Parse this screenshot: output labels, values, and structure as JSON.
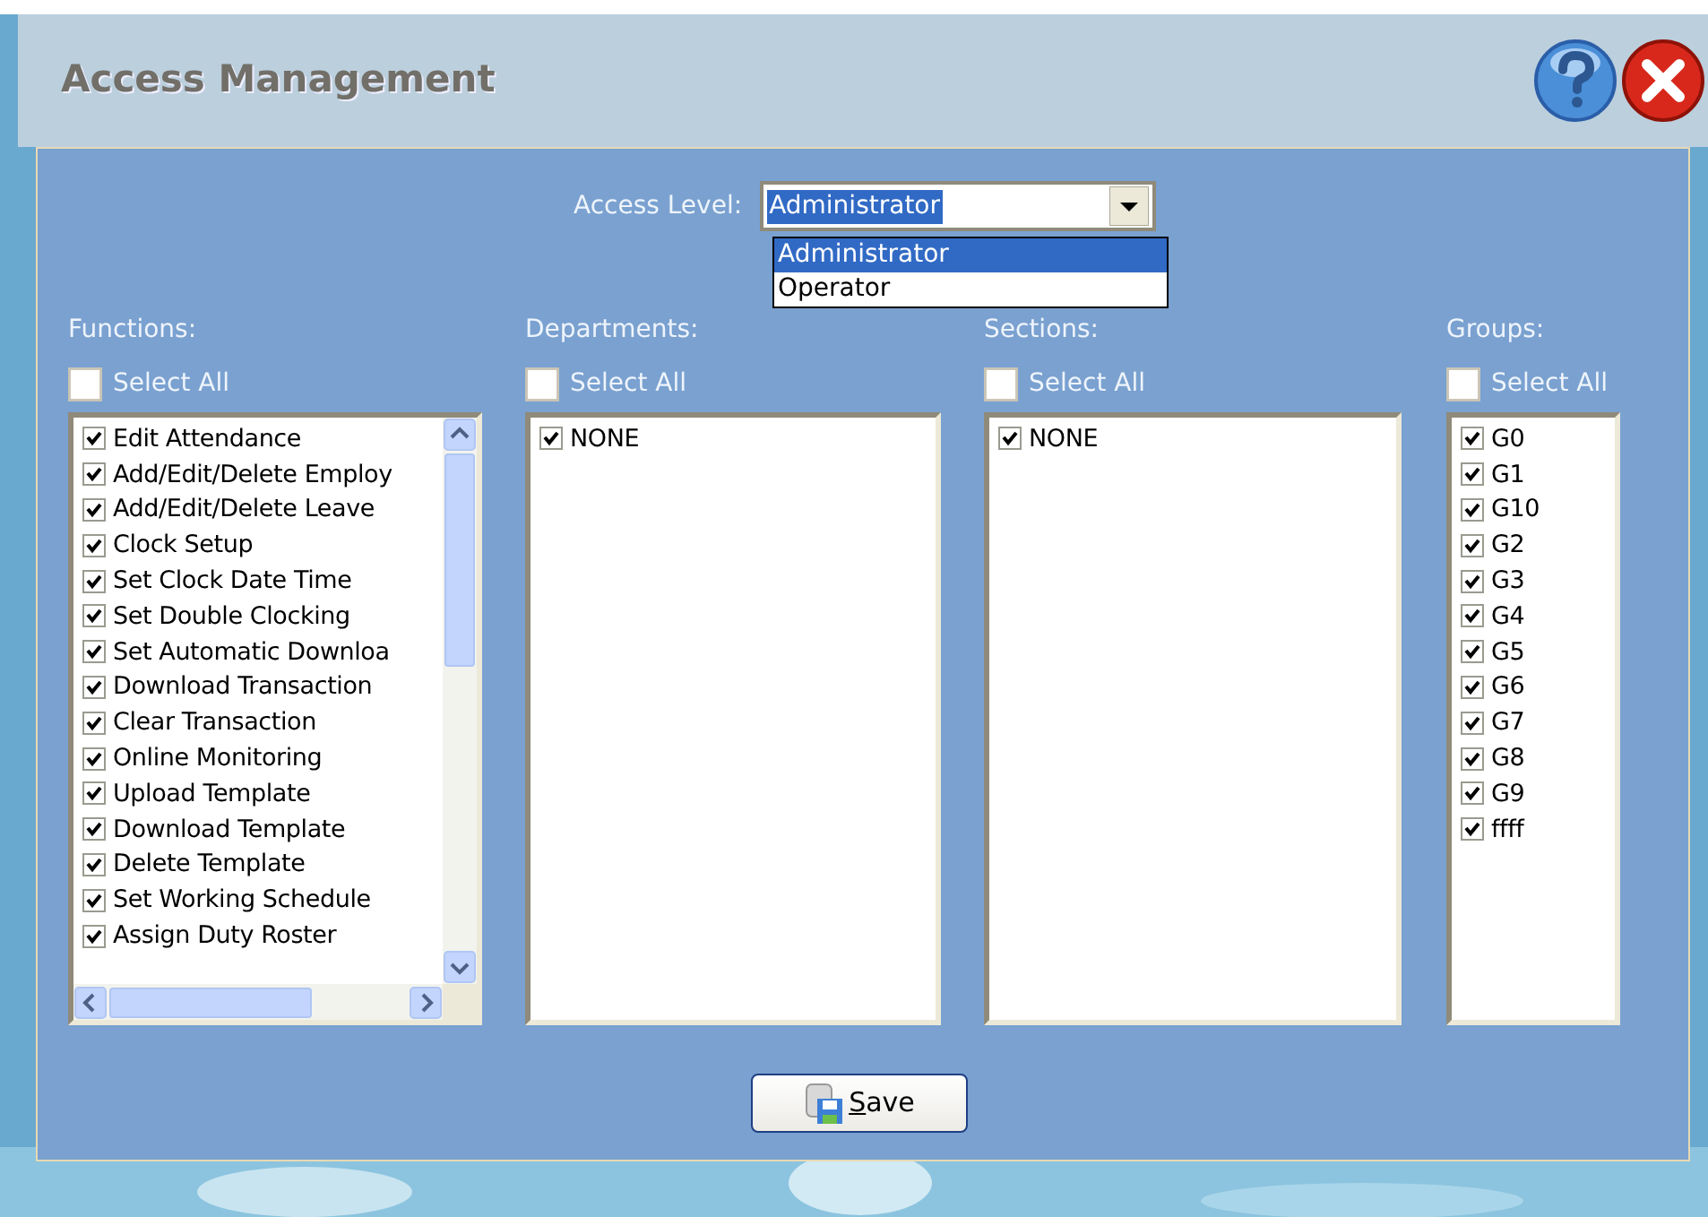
{
  "window": {
    "title": "Access Management"
  },
  "access_level": {
    "label": "Access Level:",
    "value": "Administrator",
    "expanded": true,
    "options": [
      {
        "label": "Administrator",
        "selected": true
      },
      {
        "label": "Operator",
        "selected": false
      }
    ]
  },
  "columns": [
    {
      "title": "Functions:",
      "select_all": {
        "label": "Select All",
        "checked": false
      },
      "scrollbars": true,
      "items": [
        {
          "label": "Edit Attendance",
          "checked": true
        },
        {
          "label": "Add/Edit/Delete Employ",
          "checked": true
        },
        {
          "label": "Add/Edit/Delete Leave",
          "checked": true
        },
        {
          "label": "Clock Setup",
          "checked": true
        },
        {
          "label": "Set Clock Date Time",
          "checked": true
        },
        {
          "label": "Set Double Clocking",
          "checked": true
        },
        {
          "label": "Set Automatic Downloa",
          "checked": true
        },
        {
          "label": "Download Transaction",
          "checked": true
        },
        {
          "label": "Clear Transaction",
          "checked": true
        },
        {
          "label": "Online Monitoring",
          "checked": true
        },
        {
          "label": "Upload Template",
          "checked": true
        },
        {
          "label": "Download Template",
          "checked": true
        },
        {
          "label": "Delete Template",
          "checked": true
        },
        {
          "label": "Set Working Schedule",
          "checked": true
        },
        {
          "label": "Assign Duty Roster",
          "checked": true
        }
      ]
    },
    {
      "title": "Departments:",
      "select_all": {
        "label": "Select All",
        "checked": false
      },
      "scrollbars": false,
      "items": [
        {
          "label": "NONE",
          "checked": true
        }
      ]
    },
    {
      "title": "Sections:",
      "select_all": {
        "label": "Select All",
        "checked": false
      },
      "scrollbars": false,
      "items": [
        {
          "label": "NONE",
          "checked": true
        }
      ]
    },
    {
      "title": "Groups:",
      "select_all": {
        "label": "Select All",
        "checked": false
      },
      "scrollbars": false,
      "items": [
        {
          "label": "G0",
          "checked": true
        },
        {
          "label": "G1",
          "checked": true
        },
        {
          "label": "G10",
          "checked": true
        },
        {
          "label": "G2",
          "checked": true
        },
        {
          "label": "G3",
          "checked": true
        },
        {
          "label": "G4",
          "checked": true
        },
        {
          "label": "G5",
          "checked": true
        },
        {
          "label": "G6",
          "checked": true
        },
        {
          "label": "G7",
          "checked": true
        },
        {
          "label": "G8",
          "checked": true
        },
        {
          "label": "G9",
          "checked": true
        },
        {
          "label": "ffff",
          "checked": true
        }
      ]
    }
  ],
  "save_button": {
    "label": "Save",
    "mnemonic": true
  }
}
